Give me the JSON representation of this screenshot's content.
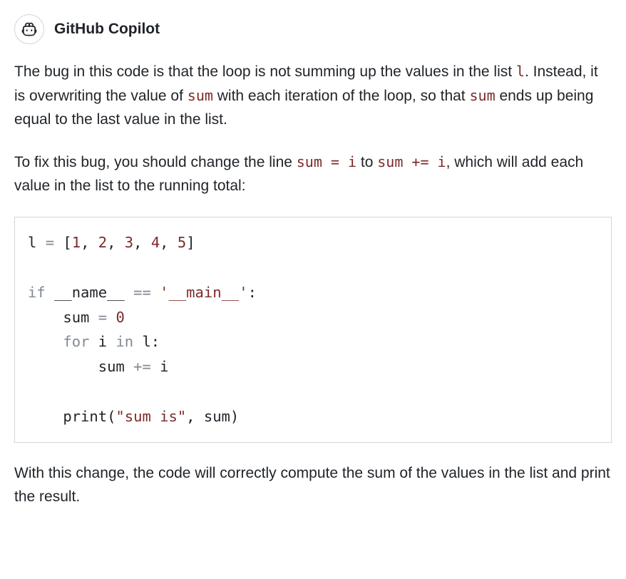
{
  "header": {
    "title": "GitHub Copilot"
  },
  "para1": {
    "t1": "The bug in this code is that the loop is not summing up the values in the list ",
    "c1": "l",
    "t2": ". Instead, it is overwriting the value of ",
    "c2": "sum",
    "t3": " with each iteration of the loop, so that ",
    "c3": "sum",
    "t4": " ends up being equal to the last value in the list."
  },
  "para2": {
    "t1": "To fix this bug, you should change the line ",
    "c1": "sum = i",
    "t2": " to ",
    "c2": "sum += i",
    "t3": ", which will add each value in the list to the running total:"
  },
  "code": {
    "l1_a": "l ",
    "l1_op": "=",
    "l1_b": " [",
    "l1_n1": "1",
    "l1_c1": ", ",
    "l1_n2": "2",
    "l1_c2": ", ",
    "l1_n3": "3",
    "l1_c3": ", ",
    "l1_n4": "4",
    "l1_c4": ", ",
    "l1_n5": "5",
    "l1_d": "]",
    "l2": "",
    "l3_kw": "if",
    "l3_a": " __name__ ",
    "l3_op": "==",
    "l3_sp": " ",
    "l3_str": "'__main__'",
    "l3_b": ":",
    "l4_a": "    sum ",
    "l4_op": "=",
    "l4_sp": " ",
    "l4_n": "0",
    "l5_pad": "    ",
    "l5_kw1": "for",
    "l5_a": " i ",
    "l5_kw2": "in",
    "l5_b": " l:",
    "l6_a": "        sum ",
    "l6_op": "+=",
    "l6_b": " i",
    "l7": "",
    "l8_a": "    print(",
    "l8_str": "\"sum is\"",
    "l8_b": ", sum)"
  },
  "para3": {
    "t1": "With this change, the code will correctly compute the sum of the values in the list and print the result."
  }
}
